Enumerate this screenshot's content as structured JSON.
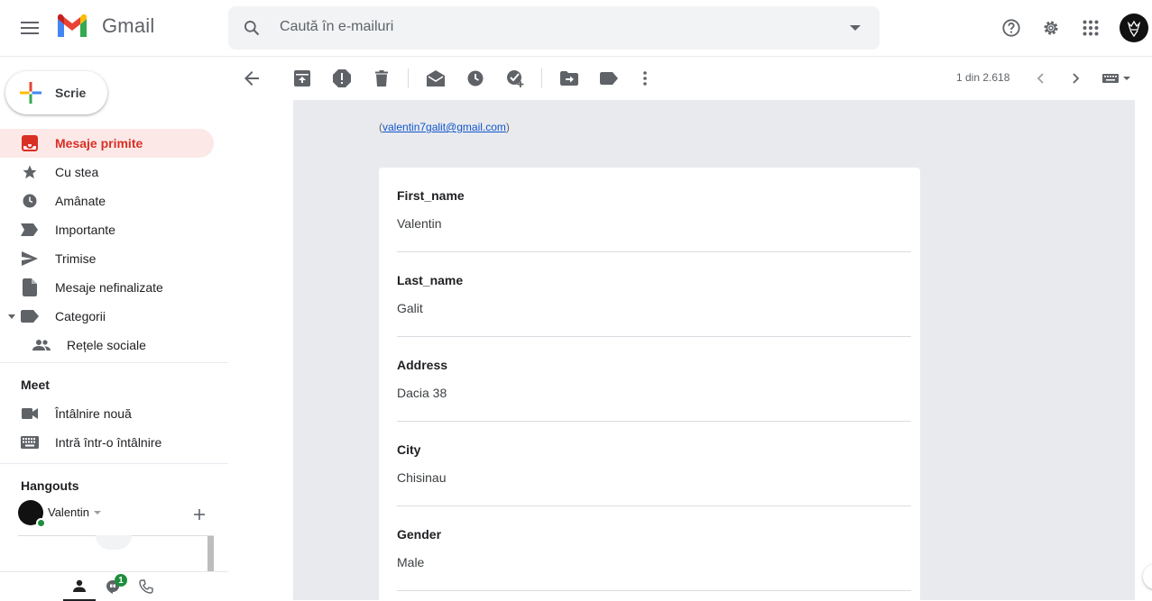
{
  "header": {
    "app_name": "Gmail",
    "search_placeholder": "Caută în e-mailuri"
  },
  "sidebar": {
    "compose_label": "Scrie",
    "items": [
      {
        "label": "Mesaje primite",
        "icon": "inbox-icon",
        "active": true
      },
      {
        "label": "Cu stea",
        "icon": "star-icon"
      },
      {
        "label": "Amânate",
        "icon": "clock-icon"
      },
      {
        "label": "Importante",
        "icon": "important-icon"
      },
      {
        "label": "Trimise",
        "icon": "send-icon"
      },
      {
        "label": "Mesaje nefinalizate",
        "icon": "draft-icon"
      },
      {
        "label": "Categorii",
        "icon": "label-icon"
      },
      {
        "label": "Rețele sociale",
        "icon": "people-icon"
      }
    ],
    "meet": {
      "title": "Meet",
      "items": [
        {
          "label": "Întâlnire nouă",
          "icon": "video-icon"
        },
        {
          "label": "Intră într-o întâlnire",
          "icon": "keyboard-icon"
        }
      ]
    },
    "hangouts": {
      "title": "Hangouts",
      "user": "Valentin",
      "badge_count": "1"
    }
  },
  "toolbar": {
    "pager_text": "1 din 2.618"
  },
  "email": {
    "sender_email": "valentin7galit@gmail.com",
    "fields": [
      {
        "label": "First_name",
        "value": "Valentin"
      },
      {
        "label": "Last_name",
        "value": "Galit"
      },
      {
        "label": "Address",
        "value": "Dacia 38"
      },
      {
        "label": "City",
        "value": "Chisinau"
      },
      {
        "label": "Gender",
        "value": "Male"
      }
    ]
  },
  "colors": {
    "accent_red": "#d93025",
    "active_bg": "#fce8e6",
    "email_bg": "#e8eaed",
    "online_green": "#1e8e3e"
  }
}
